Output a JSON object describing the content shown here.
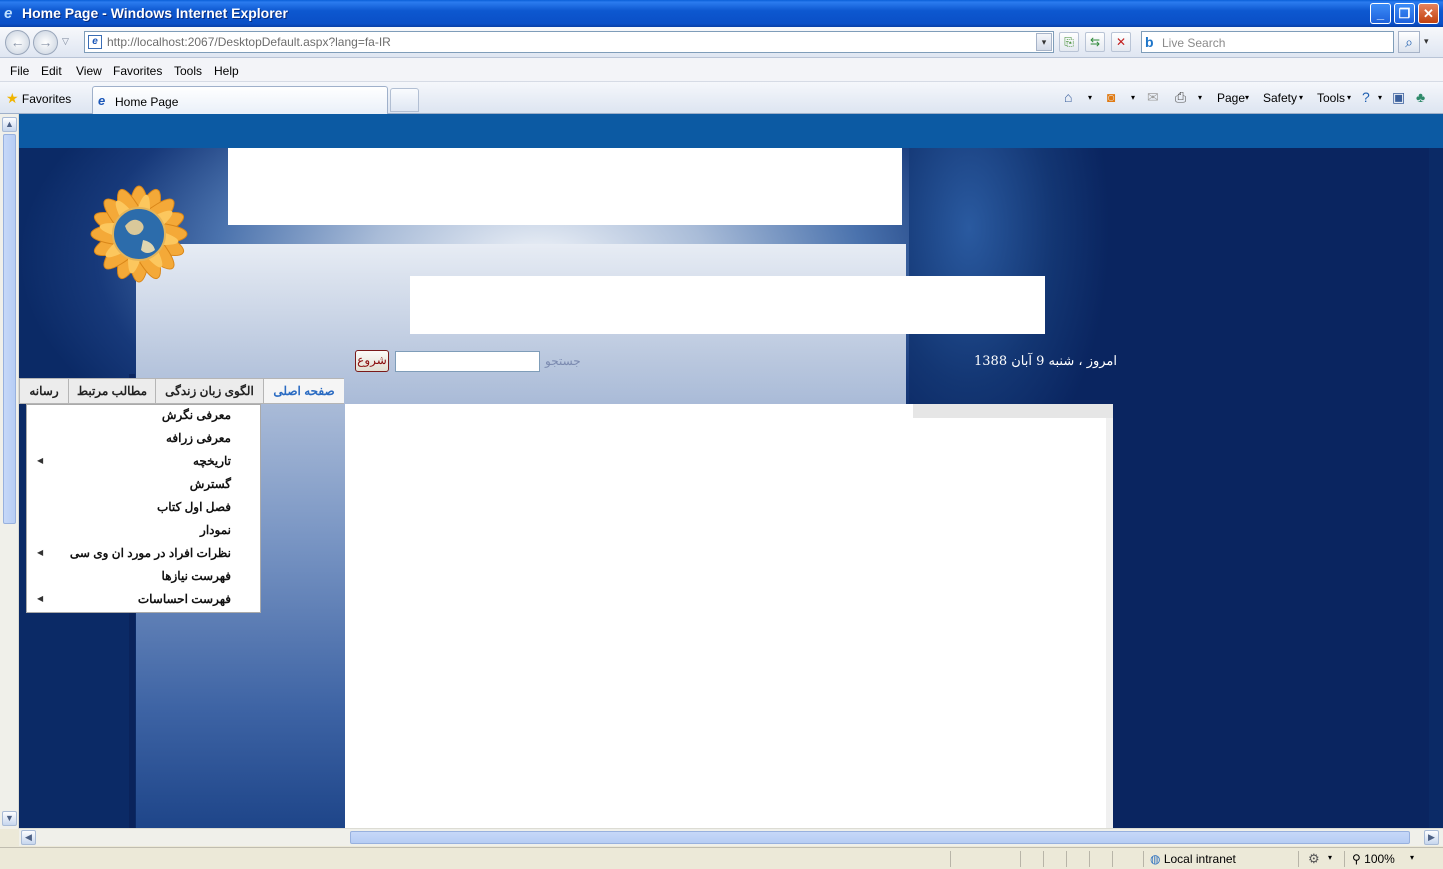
{
  "window": {
    "title": "Home Page - Windows Internet Explorer"
  },
  "address_bar": {
    "url": "http://localhost:2067/DesktopDefault.aspx?lang=fa-IR",
    "search_placeholder": "Live Search"
  },
  "menu": [
    "File",
    "Edit",
    "View",
    "Favorites",
    "Tools",
    "Help"
  ],
  "favorites_label": "Favorites",
  "tab": {
    "label": "Home Page"
  },
  "command_bar": {
    "page": "Page",
    "safety": "Safety",
    "tools": "Tools"
  },
  "site": {
    "date_text": "امروز ، شنبه 9 آبان 1388",
    "search_label": "جستجو",
    "go_label": "شروع",
    "nav": [
      {
        "label": "صفحه اصلی",
        "active": true
      },
      {
        "label": "الگوی زبان زندگی",
        "active": false
      },
      {
        "label": "مطالب مرتبط",
        "active": false
      },
      {
        "label": "رسانه",
        "active": false
      }
    ],
    "dropdown": [
      {
        "label": "معرفی نگرش",
        "has_sub": false
      },
      {
        "label": "معرفی زرافه",
        "has_sub": false
      },
      {
        "label": "تاریخچه",
        "has_sub": true
      },
      {
        "label": "گسترش",
        "has_sub": false
      },
      {
        "label": "فصل اول کتاب",
        "has_sub": false
      },
      {
        "label": "نمودار",
        "has_sub": false
      },
      {
        "label": "نظرات افراد در مورد ان وی سی",
        "has_sub": true
      },
      {
        "label": "فهرست نیازها",
        "has_sub": false
      },
      {
        "label": "فهرست احساسات",
        "has_sub": true
      }
    ]
  },
  "status_bar": {
    "zone": "Local intranet",
    "zoom": "100%"
  },
  "colors": {
    "titlebar": "#0a4fc7",
    "site_band": "#0c5aa3",
    "site_dark": "#0b2a66",
    "nav_active": "#2a6bc2"
  }
}
